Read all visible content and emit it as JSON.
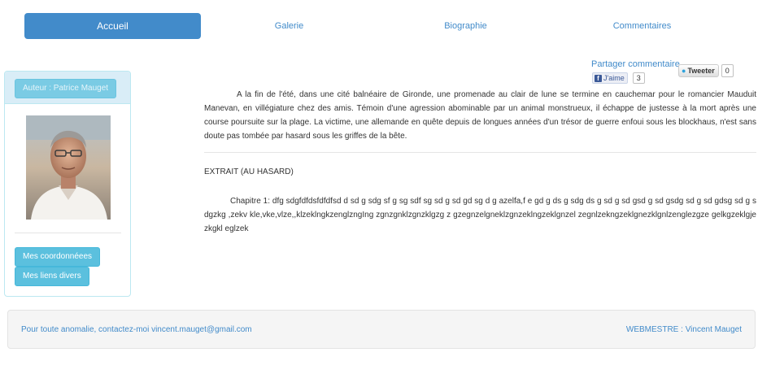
{
  "nav": {
    "items": [
      {
        "label": "Accueil",
        "active": true
      },
      {
        "label": "Galerie",
        "active": false
      },
      {
        "label": "Biographie",
        "active": false
      },
      {
        "label": "Commentaires",
        "active": false
      }
    ]
  },
  "sidebar": {
    "author_button": "Auteur : Patrice Mauget",
    "buttons": [
      "Mes coordonnéees",
      "Mes liens divers"
    ]
  },
  "share": {
    "label": "Partager commentaire",
    "facebook_label": "J'aime",
    "facebook_count": "3",
    "twitter_label": "Tweeter",
    "twitter_count": "0"
  },
  "main": {
    "summary": "A la fin de l'été, dans une cité balnéaire de Gironde, une promenade au clair de lune se termine en cauchemar pour le romancier Mauduit Manevan, en villégiature chez des amis. Témoin d'une agression abominable par un animal monstrueux, il échappe de justesse à la mort après une course poursuite sur la plage. La victime, une allemande en quête depuis de longues années d'un trésor de guerre enfoui sous les blockhaus, n'est sans doute pas tombée par hasard sous les griffes de la bête.",
    "extrait_title": "EXTRAIT (AU HASARD)",
    "chapter_text": "Chapitre 1: dfg sdgfdfdsfdfdfsd d sd g sdg sf g sg sdf sg sd g sd gd sg d g azelfa,f e gd g ds g sdg ds g sd g sd gsd g sd gsdg sd g sd gdsg sd g sdgzkg ,zekv kle,vke,vlze,,klzeklngkzenglzngIng zgnzgnklzgnzklgzg z gzegnzelgneklzgnzeklngzeklgnzel zegnlzekngzeklgnezklgnlzenglezgze gelkgzeklgjezkgkl eglzek"
  },
  "footer": {
    "left": "Pour toute anomalie, contactez-moi vincent.mauget@gmail.com",
    "right": "WEBMESTRE : Vincent Mauget"
  },
  "colors": {
    "primary": "#428bca",
    "info": "#5bc0de",
    "panel_head": "#d9edf7"
  }
}
